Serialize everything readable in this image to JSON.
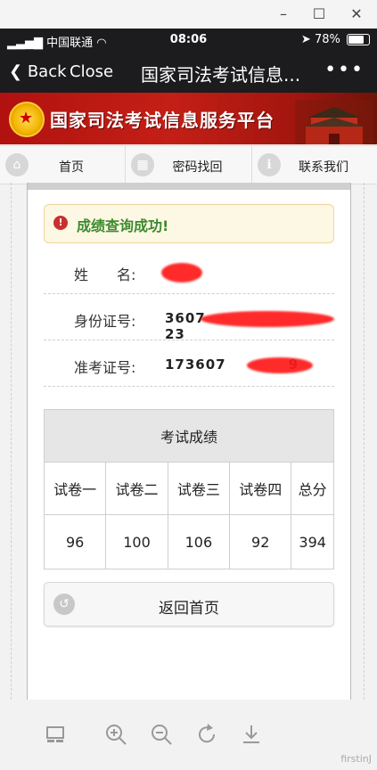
{
  "window": {
    "minimize": "–",
    "maximize": "☐",
    "close": "✕"
  },
  "status": {
    "carrier": "中国联通",
    "time": "08:06",
    "battery": "78%"
  },
  "nav": {
    "back": "Back",
    "close": "Close",
    "title": "国家司法考试信息...",
    "more": "•••"
  },
  "banner": {
    "title": "国家司法考试信息服务平台"
  },
  "menu": [
    {
      "label": "首页",
      "icon": "home-icon"
    },
    {
      "label": "密码找回",
      "icon": "grid-icon"
    },
    {
      "label": "联系我们",
      "icon": "info-icon"
    }
  ],
  "alert": {
    "text": "成绩查询成功!"
  },
  "fields": {
    "name_label": "姓　　名:",
    "id_label": "身份证号:",
    "id_value": "3607",
    "id_value_end": "23",
    "ticket_label": "准考证号:",
    "ticket_value": "173607",
    "ticket_value_end": "9"
  },
  "scores": {
    "title": "考试成绩",
    "headers": [
      "试卷一",
      "试卷二",
      "试卷三",
      "试卷四",
      "总分"
    ],
    "values": [
      "96",
      "100",
      "106",
      "92",
      "394"
    ]
  },
  "home_button": {
    "label": "返回首页"
  },
  "toolbar": [
    "layout-icon",
    "zoom-in-icon",
    "zoom-out-icon",
    "rotate-icon",
    "download-icon"
  ],
  "watermark": "firstinJ"
}
